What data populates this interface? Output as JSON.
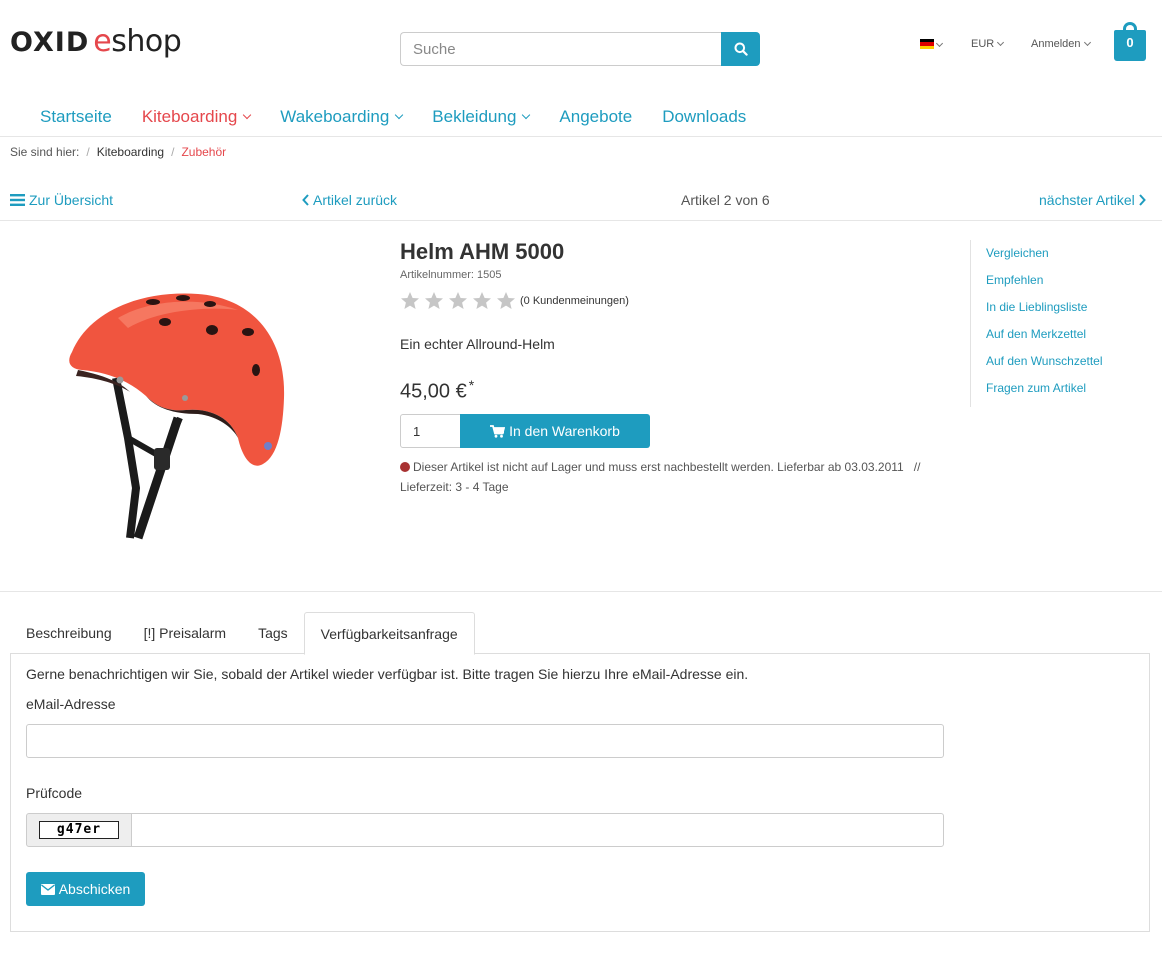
{
  "header": {
    "logo_part1": "OXID",
    "logo_part2_e": "e",
    "logo_part2_rest": "shop",
    "search_placeholder": "Suche",
    "currency": "EUR",
    "login": "Anmelden",
    "cart_count": "0",
    "language_flag": "flag-de-icon"
  },
  "nav": {
    "items": [
      {
        "label": "Startseite",
        "dropdown": false
      },
      {
        "label": "Kiteboarding",
        "dropdown": true,
        "active": true
      },
      {
        "label": "Wakeboarding",
        "dropdown": true
      },
      {
        "label": "Bekleidung",
        "dropdown": true
      },
      {
        "label": "Angebote",
        "dropdown": false
      },
      {
        "label": "Downloads",
        "dropdown": false
      }
    ]
  },
  "breadcrumb": {
    "prefix": "Sie sind hier:",
    "items": [
      "Kiteboarding",
      "Zubehör"
    ]
  },
  "detail_nav": {
    "overview": "Zur Übersicht",
    "prev": "Artikel zurück",
    "position": "Artikel 2 von 6",
    "next": "nächster Artikel"
  },
  "product": {
    "title": "Helm AHM 5000",
    "article_number": "Artikelnummer: 1505",
    "rating_stars": 0,
    "rating_max": 5,
    "reviews": "(0 Kundenmeinungen)",
    "short_description": "Ein echter Allround-Helm",
    "price": "45,00 €",
    "price_note": "*",
    "quantity": "1",
    "to_cart": "In den Warenkorb",
    "stock_message": "Dieser Artikel ist nicht auf Lager und muss erst nachbestellt werden. Lieferbar ab 03.03.2011",
    "stock_separator": "//",
    "delivery_time": "Lieferzeit: 3 - 4 Tage",
    "colors": {
      "accent": "#1e9cbf",
      "active": "#e5474c",
      "helmet": "#f0553f",
      "stock_dot": "#a83232"
    }
  },
  "side_links": [
    "Vergleichen",
    "Empfehlen",
    "In die Lieblingsliste",
    "Auf den Merkzettel",
    "Auf den Wunschzettel",
    "Fragen zum Artikel"
  ],
  "tabs": [
    "Beschreibung",
    "[!] Preisalarm",
    "Tags",
    "Verfügbarkeitsanfrage"
  ],
  "availability_form": {
    "intro": "Gerne benachrichtigen wir Sie, sobald der Artikel wieder verfügbar ist. Bitte tragen Sie hierzu Ihre eMail-Adresse ein.",
    "email_label": "eMail-Adresse",
    "email_value": "",
    "captcha_label": "Prüfcode",
    "captcha_code": "g47er",
    "captcha_value": "",
    "submit": "Abschicken"
  }
}
